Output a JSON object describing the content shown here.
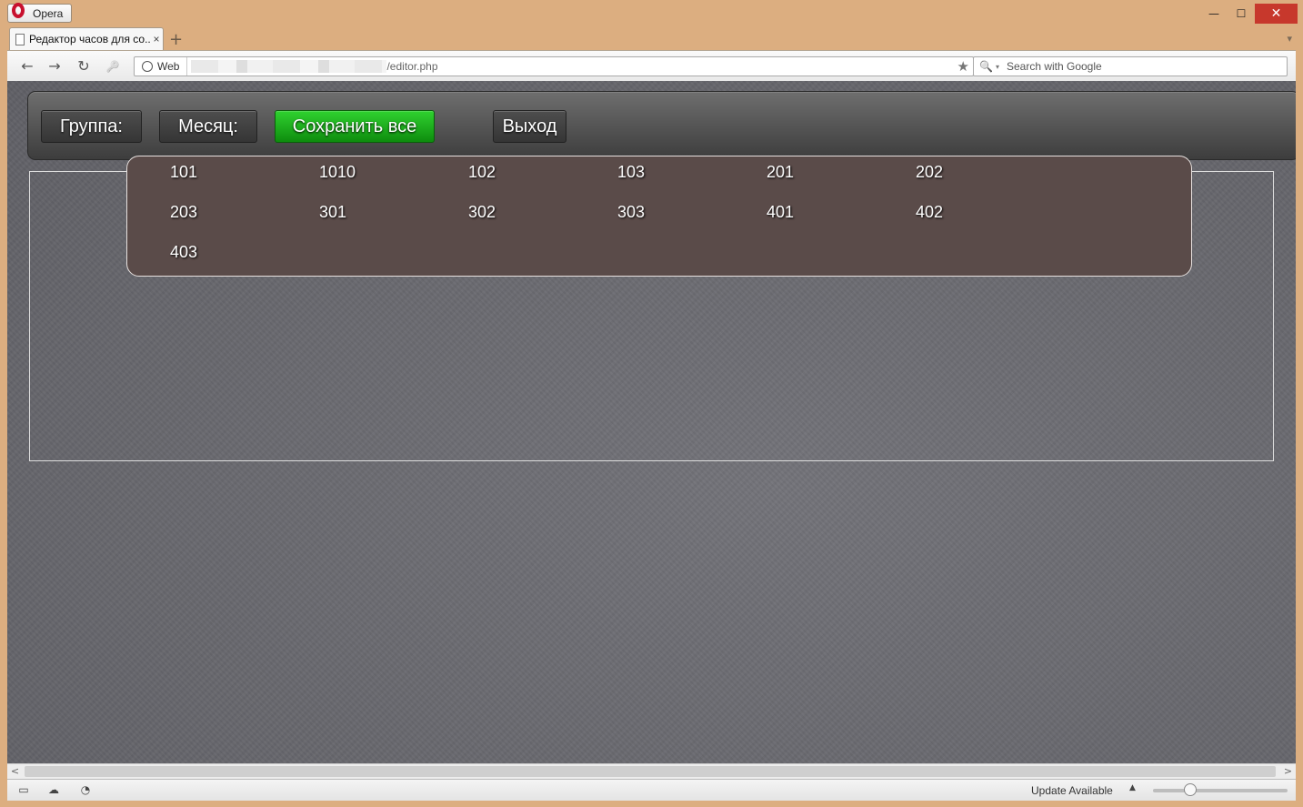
{
  "browser": {
    "menu_label": "Opera",
    "tab": {
      "title": "Редактор часов для со...",
      "close": "×"
    },
    "new_tab": "+",
    "tab_menu": "▾",
    "window_controls": {
      "minimize": "—",
      "maximize": "☐",
      "close": "✕"
    },
    "nav": {
      "back": "←",
      "forward": "→",
      "reload": "↻",
      "key": "🔑"
    },
    "address": {
      "badge": "Web",
      "url": "/editor.php",
      "bookmark": "★"
    },
    "search": {
      "placeholder": "Search with Google",
      "icon": "🔍",
      "caret": "▾"
    }
  },
  "app": {
    "buttons": {
      "group": "Группа:",
      "month": "Месяц:",
      "save_all": "Сохранить все",
      "exit": "Выход"
    },
    "group_popup": {
      "items": [
        "101",
        "1010",
        "102",
        "103",
        "201",
        "202",
        "203",
        "301",
        "302",
        "303",
        "401",
        "402",
        "403"
      ]
    },
    "colors": {
      "save_button": "#1fb01f",
      "popup_bg": "#5a4b49"
    }
  },
  "status": {
    "update": "Update Available",
    "update_arrow": "▲",
    "scroll_left": "<",
    "scroll_right": ">"
  }
}
